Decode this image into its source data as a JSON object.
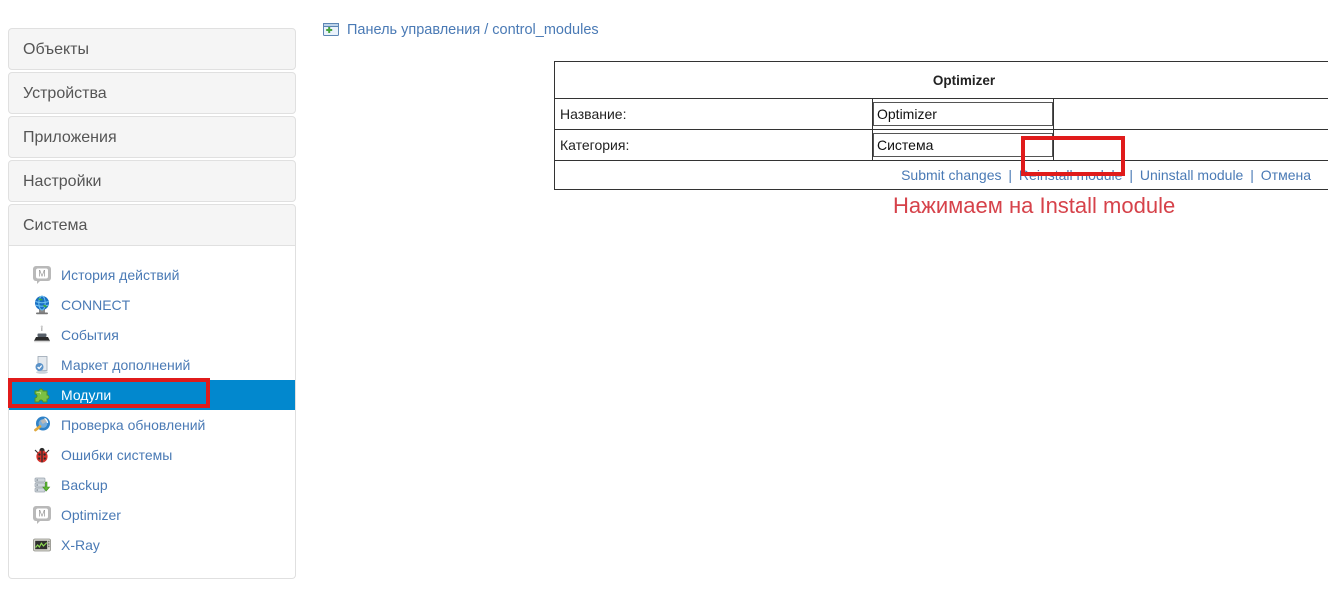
{
  "breadcrumb": {
    "icon": "window-plus-icon",
    "root": "Панель управления",
    "separator": "/",
    "current": "control_modules"
  },
  "sidebar": {
    "sections": [
      {
        "label": "Объекты",
        "open": false
      },
      {
        "label": "Устройства",
        "open": false
      },
      {
        "label": "Приложения",
        "open": false
      },
      {
        "label": "Настройки",
        "open": false
      },
      {
        "label": "Система",
        "open": true
      }
    ],
    "items": [
      {
        "label": "История действий",
        "icon": "message-m-icon",
        "active": false
      },
      {
        "label": "CONNECT",
        "icon": "globe-icon",
        "active": false
      },
      {
        "label": "События",
        "icon": "scanner-icon",
        "active": false
      },
      {
        "label": "Маркет дополнений",
        "icon": "market-icon",
        "active": false
      },
      {
        "label": "Модули",
        "icon": "puzzle-icon",
        "active": true
      },
      {
        "label": "Проверка обновлений",
        "icon": "update-hammer-icon",
        "active": false
      },
      {
        "label": "Ошибки системы",
        "icon": "ladybug-icon",
        "active": false
      },
      {
        "label": "Backup",
        "icon": "database-down-icon",
        "active": false
      },
      {
        "label": "Optimizer",
        "icon": "message-m-icon",
        "active": false
      },
      {
        "label": "X-Ray",
        "icon": "monitor-chart-icon",
        "active": false
      }
    ]
  },
  "module_panel": {
    "title": "Optimizer",
    "rows": [
      {
        "label": "Название:",
        "value": "Optimizer"
      },
      {
        "label": "Категория:",
        "value": "Система"
      }
    ],
    "actions": [
      {
        "label": "Submit changes",
        "name": "submit-changes-link"
      },
      {
        "label": "Reinstall module",
        "name": "reinstall-module-link"
      },
      {
        "label": "Uninstall module",
        "name": "uninstall-module-link"
      },
      {
        "label": "Отмена",
        "name": "cancel-link"
      }
    ],
    "action_separator": "|"
  },
  "annotation": {
    "text": "Нажимаем на Install module",
    "color": "#d6424a"
  },
  "colors": {
    "accent_blue": "#0288ce",
    "link_blue": "#4a7ab5",
    "highlight_red": "#e01b1b",
    "panel_bg": "#f5f5f5"
  }
}
